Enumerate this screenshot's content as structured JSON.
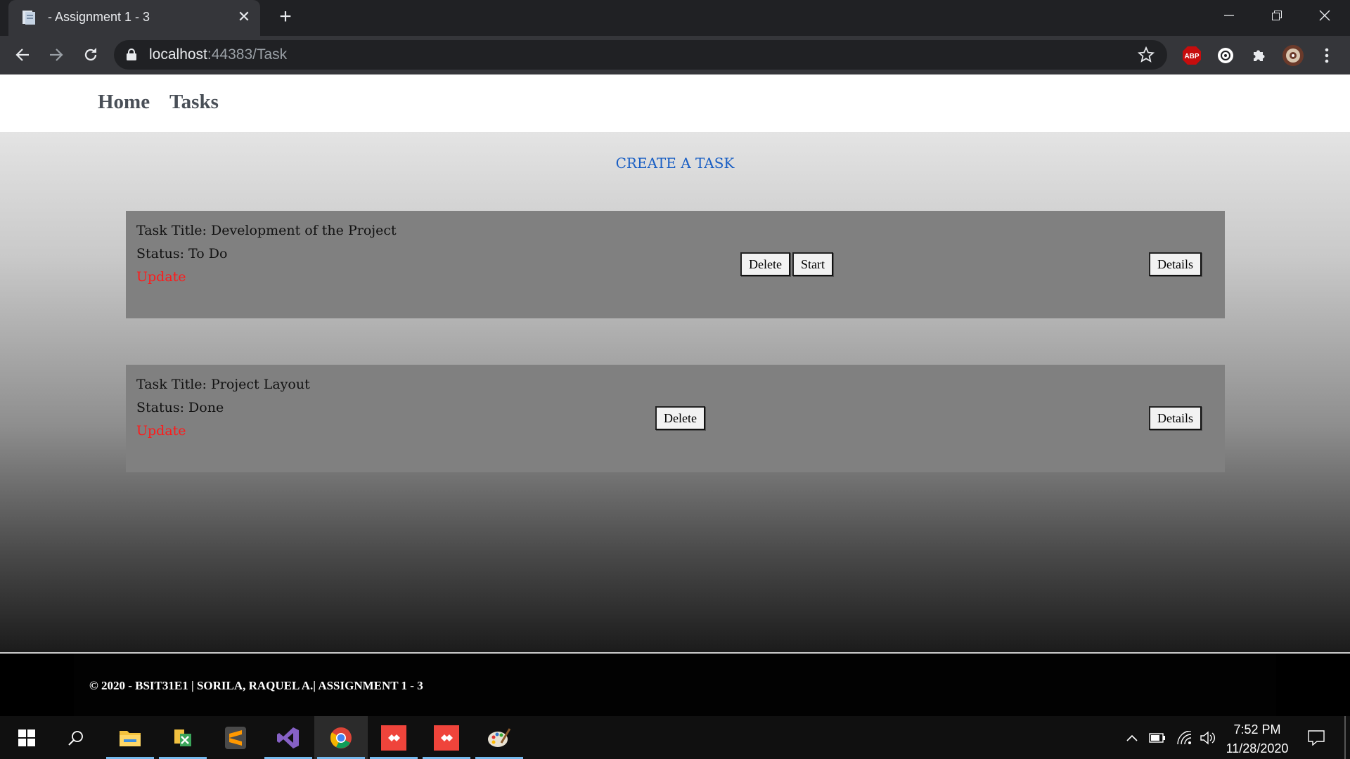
{
  "browser": {
    "tab_title": "- Assignment 1 - 3",
    "url_host": "localhost",
    "url_rest": ":44383/Task",
    "extension_abp_label": "ABP"
  },
  "site": {
    "nav": {
      "home": "Home",
      "tasks": "Tasks"
    },
    "create_link": "CREATE A TASK",
    "tasks": [
      {
        "title_line": "Task Title: Development of the Project",
        "status_line": "Status: To Do",
        "update": "Update",
        "delete": "Delete",
        "start": "Start",
        "details": "Details"
      },
      {
        "title_line": "Task Title: Project Layout",
        "status_line": "Status: Done",
        "update": "Update",
        "delete": "Delete",
        "details": "Details"
      }
    ],
    "footer": "© 2020 - BSIT31E1 | SORILA, RAQUEL A.| ASSIGNMENT 1 - 3"
  },
  "taskbar": {
    "time": "7:52 PM",
    "date": "11/28/2020",
    "pinned": [
      "start-icon",
      "search-icon",
      "file-explorer-icon",
      "sql-tool-icon",
      "sublime-text-icon",
      "visual-studio-icon",
      "chrome-icon",
      "anydesk-icon",
      "anydesk-icon",
      "paint-icon"
    ]
  }
}
